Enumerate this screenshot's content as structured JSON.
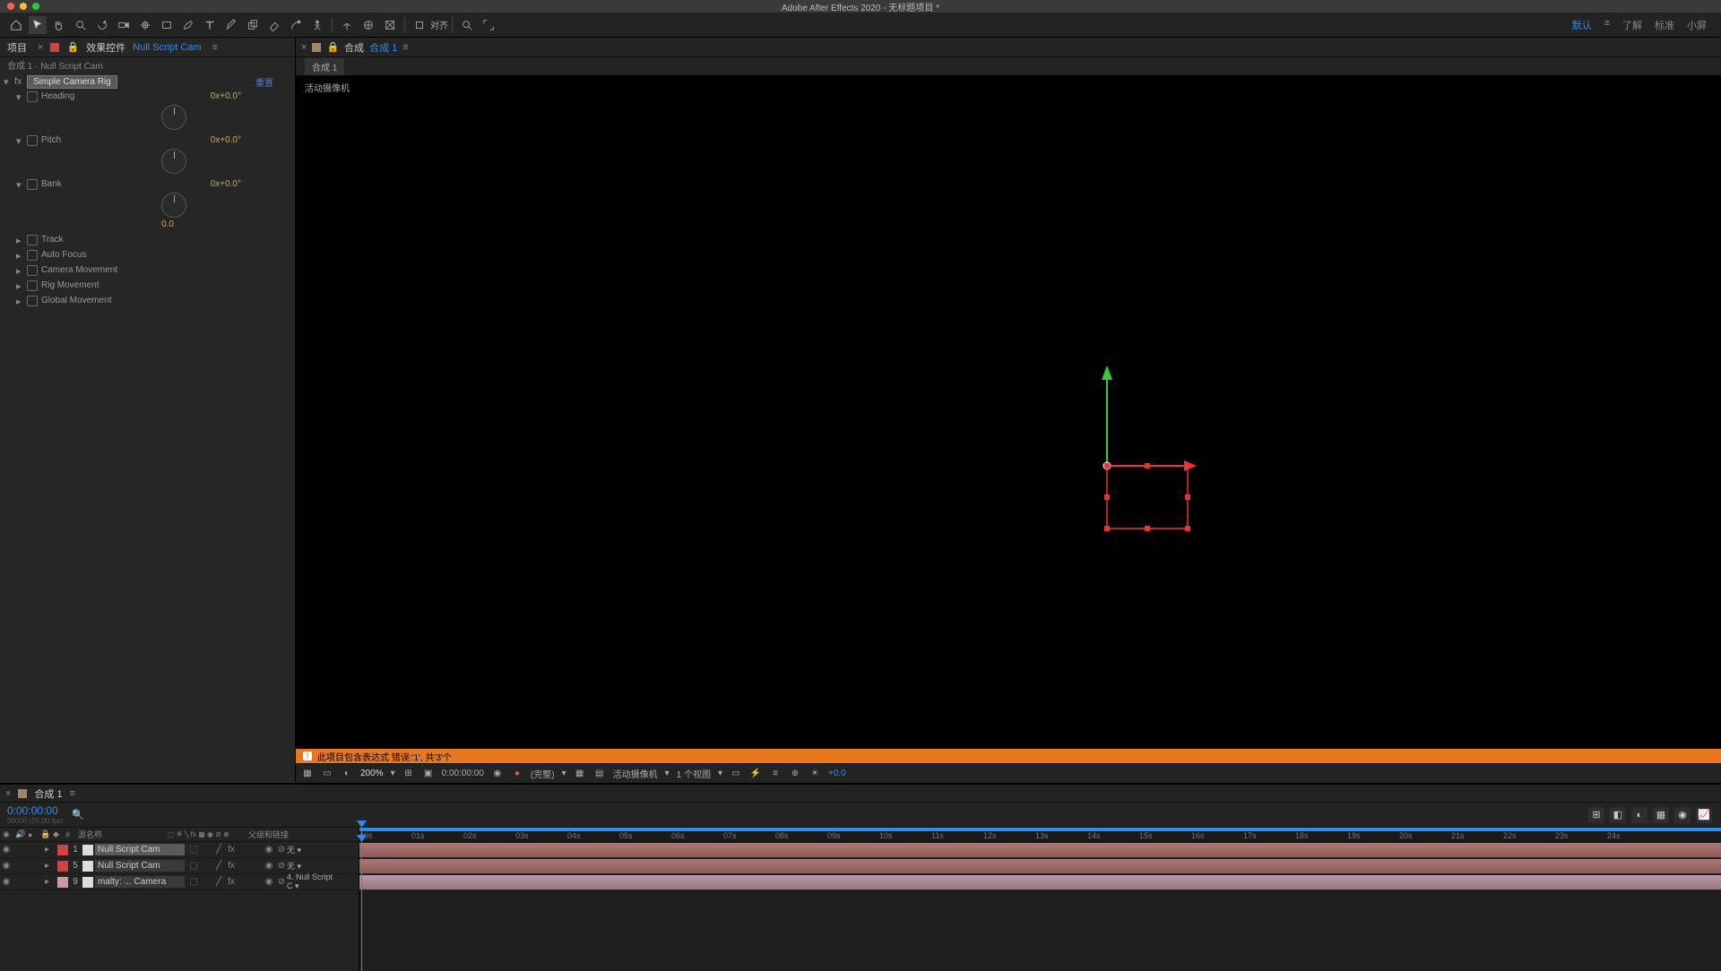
{
  "app": {
    "title": "Adobe After Effects 2020 - 无标题项目 *"
  },
  "workspace": {
    "items": [
      "默认",
      "了解",
      "标准",
      "小屏"
    ],
    "active": 0
  },
  "toolbar": {
    "snap_label": "对齐"
  },
  "left_panel": {
    "tab_project": "项目",
    "tab_fx_prefix": "效果控件",
    "tab_fx_link": "Null Script Cam",
    "breadcrumb": "合成 1 · Null Script Cam",
    "effect_name": "Simple Camera Rig",
    "reset": "重置",
    "rotation_value": "0x+0.0°",
    "zero_value": "0.0",
    "props": [
      {
        "name": "Heading",
        "open": true,
        "dial": true
      },
      {
        "name": "Pitch",
        "open": true,
        "dial": true
      },
      {
        "name": "Bank",
        "open": true,
        "dial": true,
        "showZero": true
      },
      {
        "name": "Track",
        "open": false
      },
      {
        "name": "Auto Focus",
        "open": false
      },
      {
        "name": "Camera Movement",
        "open": false
      },
      {
        "name": "Rig Movement",
        "open": false
      },
      {
        "name": "Global Movement",
        "open": false
      }
    ]
  },
  "comp_panel": {
    "tab_prefix": "合成",
    "tab_name": "合成 1",
    "sub_chip": "合成 1",
    "vp_label": "活动摄像机",
    "warning": "此项目包含表达式 错误:'1', 共'3'个",
    "footer": {
      "zoom": "200%",
      "time": "0:00:00:00",
      "resolution": "(完整)",
      "camera": "活动摄像机",
      "views": "1 个视图",
      "exposure": "+0.0"
    }
  },
  "timeline": {
    "tab_name": "合成 1",
    "time": "0:00:00:00",
    "fps_hint": "00000 (25.00 fps)",
    "col_source": "源名称",
    "col_switches": "单 ※ \\ fx 圆 ⊘ ⊙ ⊕",
    "col_parent": "父级和链接",
    "parent_none": "无",
    "parent_cam": "4. Null Script C",
    "ticks": [
      "00s",
      "01s",
      "02s",
      "03s",
      "04s",
      "05s",
      "06s",
      "07s",
      "08s",
      "09s",
      "10s",
      "11s",
      "12s",
      "13s",
      "14s",
      "15s",
      "16s",
      "17s",
      "18s",
      "19s",
      "20s",
      "21s",
      "22s",
      "23s",
      "24s"
    ],
    "layers": [
      {
        "n": "1",
        "color": "#cc4444",
        "name": "Null Script Cam",
        "selected": true,
        "parent": "无"
      },
      {
        "n": "5",
        "color": "#cc4444",
        "name": "Null Script Cam",
        "selected": false,
        "parent": "无"
      },
      {
        "n": "9",
        "color": "#c89aa5",
        "name": "malty: ... Camera",
        "selected": false,
        "parent": "4. Null Script C"
      }
    ]
  }
}
